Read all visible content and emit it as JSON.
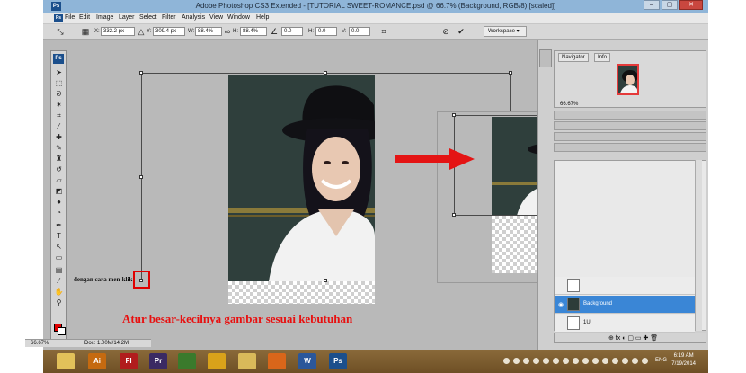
{
  "window": {
    "title": "Adobe Photoshop CS3 Extended - [TUTORIAL SWEET-ROMANCE.psd @ 66.7% (Background, RGB/8) [scaled]]",
    "controls": [
      "–",
      "▢",
      "✕"
    ]
  },
  "menu": [
    "File",
    "Edit",
    "Image",
    "Layer",
    "Select",
    "Filter",
    "Analysis",
    "View",
    "Window",
    "Help"
  ],
  "options": {
    "x_label": "X:",
    "x_value": "332.2 px",
    "y_label": "Y:",
    "y_value": "309.4 px",
    "w_label": "W:",
    "w_value": "88.4%",
    "h_label": "H:",
    "h_value": "88.4%",
    "angle_value": "0.0",
    "h_skew_label": "H:",
    "h_skew_value": "0.0",
    "v_skew_label": "V:",
    "v_skew_value": "0.0",
    "cancel_icon": "cancel-transform-icon",
    "commit_icon": "commit-transform-icon",
    "workspace_label": "Workspace ▾"
  },
  "annotations": {
    "click_note": "dengan cara men-klik",
    "resize_note": "Atur besar-kecilnya gambar sesuai kebutuhan"
  },
  "status": {
    "zoom": "66.67%",
    "doc_info": "Doc: 1.00M/14.2M"
  },
  "panels": {
    "navigator_tab": "Navigator",
    "info_tab": "Info",
    "nav_zoom": "66.67%",
    "layers": [
      {
        "name": "",
        "visible": false,
        "selected": false
      },
      {
        "name": "Background",
        "visible": true,
        "selected": true
      },
      {
        "name": "1U",
        "visible": false,
        "selected": false
      }
    ],
    "footer_icons": "⊕ fx ◐ ▢ ▭ ✚ 🗑"
  },
  "taskbar": {
    "apps": [
      {
        "icon": "file-explorer-icon",
        "label": "",
        "color": "#e2c15a"
      },
      {
        "icon": "illustrator-icon",
        "label": "Ai",
        "color": "#c56a10"
      },
      {
        "icon": "flash-icon",
        "label": "Fl",
        "color": "#b11d1d"
      },
      {
        "icon": "premiere-icon",
        "label": "Pr",
        "color": "#3b2a63"
      },
      {
        "icon": "globe-icon",
        "label": "",
        "color": "#3a7a2c"
      },
      {
        "icon": "chrome-icon",
        "label": "",
        "color": "#d9a21a"
      },
      {
        "icon": "folder-icon",
        "label": "",
        "color": "#d9b95a"
      },
      {
        "icon": "firefox-icon",
        "label": "",
        "color": "#d9661a"
      },
      {
        "icon": "word-icon",
        "label": "W",
        "color": "#2b579a"
      },
      {
        "icon": "photoshop-icon",
        "label": "Ps",
        "color": "#1b4f8c"
      }
    ],
    "language": "ENG",
    "time": "6:19 AM",
    "date": "7/19/2014"
  },
  "colors": {
    "accent_red": "#e00000",
    "selected_layer": "#3a86d6"
  }
}
